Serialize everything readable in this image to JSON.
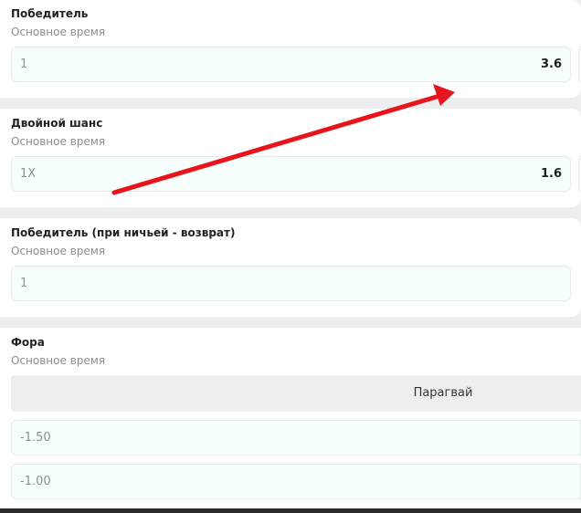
{
  "markets": [
    {
      "title": "Победитель",
      "subtitle": "Основное время",
      "rows": [
        {
          "label": "1",
          "odds": "3.6"
        }
      ]
    },
    {
      "title": "Двойной шанс",
      "subtitle": "Основное время",
      "rows": [
        {
          "label": "1X",
          "odds": "1.6"
        }
      ]
    },
    {
      "title": "Победитель (при ничьей - возврат)",
      "subtitle": "Основное время",
      "rows": [
        {
          "label": "1",
          "odds": ""
        }
      ]
    },
    {
      "title": "Фора",
      "subtitle": "Основное время",
      "team": "Парагвай",
      "rows": [
        {
          "label": "-1.50",
          "odds": ""
        },
        {
          "label": "-1.00",
          "odds": ""
        }
      ]
    }
  ],
  "colors": {
    "row_bg": "#f6fffb",
    "arrow": "#e8141b",
    "page_bg": "#eceeef"
  }
}
